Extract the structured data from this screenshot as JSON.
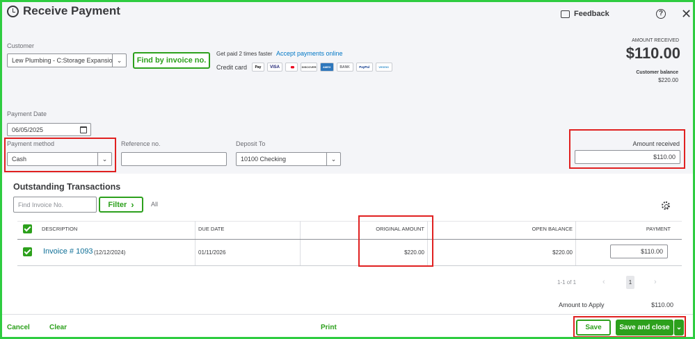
{
  "header": {
    "title": "Receive Payment",
    "feedback_label": "Feedback",
    "help_glyph": "?",
    "close_glyph": "✕",
    "icons": {
      "history": "history-icon",
      "feedback": "chat-icon",
      "help": "help-icon",
      "close": "close-icon"
    }
  },
  "customer": {
    "label": "Customer",
    "value": "Lew Plumbing - C:Storage Expansio",
    "find_button": "Find by invoice no."
  },
  "payments_promo": {
    "text": "Get paid 2 times faster",
    "link": "Accept payments online",
    "credit_card_label": "Credit card",
    "cards": [
      "Pay",
      "VISA",
      "●●",
      "DISCOVER",
      "AMEX",
      "BANK",
      "PayPal",
      "venmo"
    ]
  },
  "amount_summary": {
    "label": "AMOUNT RECEIVED",
    "value": "$110.00",
    "balance_label": "Customer balance",
    "balance_value": "$220.00"
  },
  "payment_date": {
    "label": "Payment Date",
    "value": "06/05/2025"
  },
  "payment_method": {
    "label": "Payment method",
    "value": "Cash"
  },
  "reference": {
    "label": "Reference no.",
    "value": ""
  },
  "deposit_to": {
    "label": "Deposit To",
    "value": "10100 Checking"
  },
  "amount_received": {
    "label": "Amount received",
    "value": "$110.00"
  },
  "outstanding": {
    "title": "Outstanding Transactions",
    "search_placeholder": "Find Invoice No.",
    "filter_label": "Filter",
    "filter_chevron": "›",
    "all_label": "All",
    "columns": [
      "DESCRIPTION",
      "DUE DATE",
      "ORIGINAL AMOUNT",
      "OPEN BALANCE",
      "PAYMENT"
    ],
    "rows": [
      {
        "checked": true,
        "invoice": "Invoice # 1093",
        "invoice_date": "(12/12/2024)",
        "due_date": "01/11/2026",
        "original_amount": "$220.00",
        "open_balance": "$220.00",
        "payment": "$110.00"
      }
    ],
    "pagination": {
      "range": "1-1 of 1",
      "prev": "‹",
      "page": "1",
      "next": "›"
    },
    "amount_to_apply_label": "Amount to Apply",
    "amount_to_apply_value": "$110.00"
  },
  "footer": {
    "cancel": "Cancel",
    "clear": "Clear",
    "print": "Print",
    "save": "Save",
    "save_close": "Save and close",
    "dropdown_glyph": "⌄"
  },
  "colors": {
    "accent_green": "#2ca01c",
    "highlight_red": "#e02020",
    "frame_green": "#2ecc40",
    "link_blue": "#0077c5"
  }
}
